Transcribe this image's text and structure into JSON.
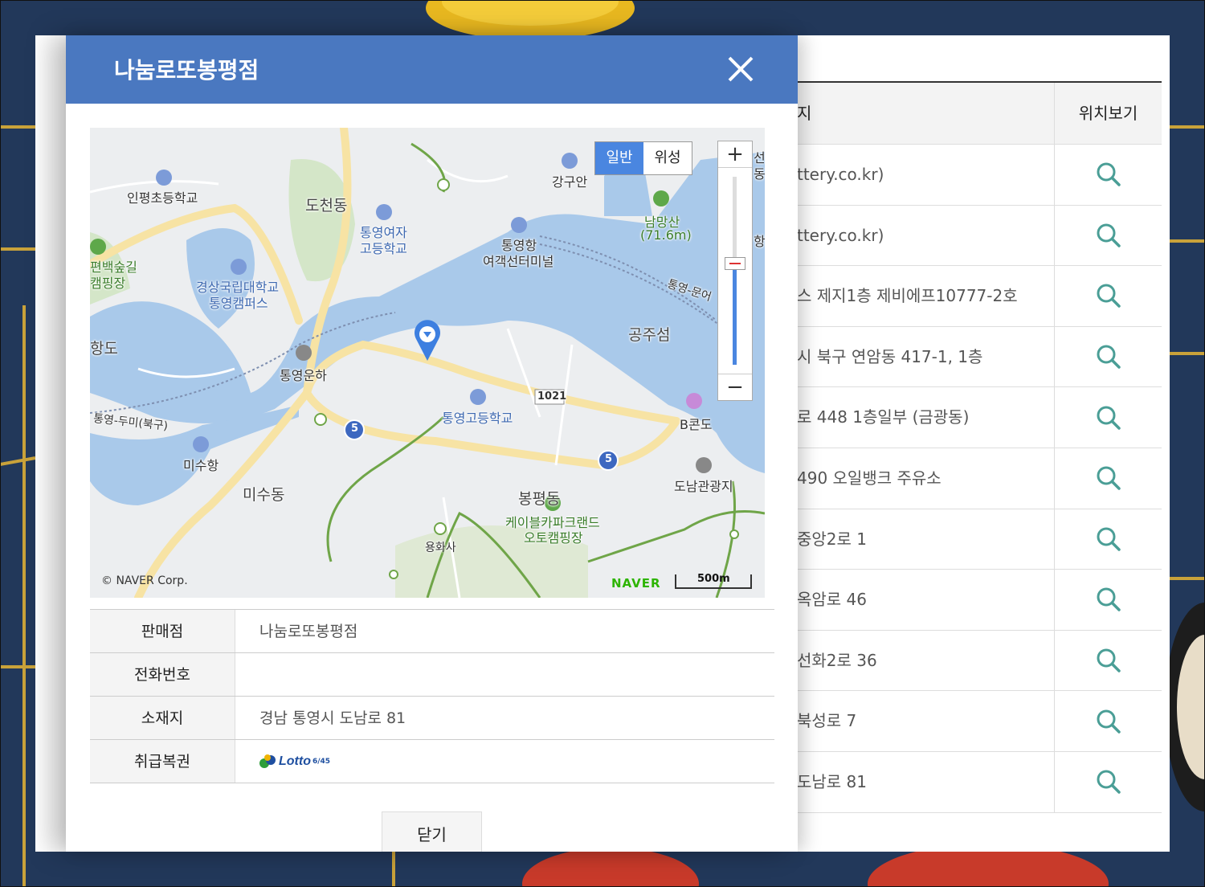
{
  "modal": {
    "title": "나눔로또봉평점",
    "close_button": "닫기",
    "map": {
      "type_normal": "일반",
      "type_satellite": "위성",
      "zoom_in": "+",
      "zoom_out": "−",
      "copyright": "© NAVER Corp.",
      "logo": "NAVER",
      "scale": "500m",
      "labels": {
        "inpyeong": "인평초등학교",
        "docheon": "도천동",
        "tongyeong_girls_1": "통영여자",
        "tongyeong_girls_2": "고등학교",
        "ganggu": "강구안",
        "nammangsan_1": "남망산",
        "nammangsan_2": "(71.6m)",
        "harbor_1": "통영항",
        "harbor_2": "여객선터미널",
        "forest_1": "편백숲길",
        "forest_2": "캠핑장",
        "univ_1": "경상국립대학교",
        "univ_2": "통영캠퍼스",
        "hangdo": "항도",
        "canal": "통영운하",
        "gongjuseom": "공주섬",
        "ferry_route": "통영-문어",
        "route_1021": "1021",
        "tongyeong_high": "통영고등학교",
        "bcondo": "B콘도",
        "dumi": "통영-두미(북구)",
        "misu_port": "미수항",
        "misu_dong": "미수동",
        "bongpyeong": "봉평동",
        "cable_1": "케이블카파크랜드",
        "cable_2": "오토캠핑장",
        "donam": "도남관광지",
        "yonghwasa": "용화사",
        "route_5a": "5",
        "route_5b": "5",
        "edge_right_1": "선",
        "edge_right_2": "동",
        "edge_right_3": "항"
      }
    },
    "info": [
      {
        "key": "판매점",
        "value": "나눔로또봉평점"
      },
      {
        "key": "전화번호",
        "value": ""
      },
      {
        "key": "소재지",
        "value": "경남 통영시 도남로 81"
      },
      {
        "key": "취급복권",
        "value": ""
      }
    ],
    "lotto_logo_text": "Lotto",
    "lotto_logo_num": "6/45"
  },
  "list": {
    "header_addr": "지",
    "header_loc": "위치보기",
    "rows": [
      "ttery.co.kr)",
      "ttery.co.kr)",
      "스 제지1층 제비에프10777-2호",
      "시 북구 연암동 417-1, 1층",
      "로 448 1층일부 (금광동)",
      "490 오일뱅크 주유소",
      "중앙2로 1",
      "옥암로 46",
      "선화2로 36",
      "북성로 7",
      "도남로 81"
    ]
  },
  "colors": {
    "header_blue": "#4a78c0",
    "search_icon": "#4a9e96",
    "map_water": "#a9c9ea",
    "map_road": "#f7e3a4"
  },
  "icons": [
    "close-icon",
    "search-icon",
    "map-pin-icon",
    "school-icon",
    "camping-icon",
    "flag-icon",
    "hotel-icon"
  ]
}
